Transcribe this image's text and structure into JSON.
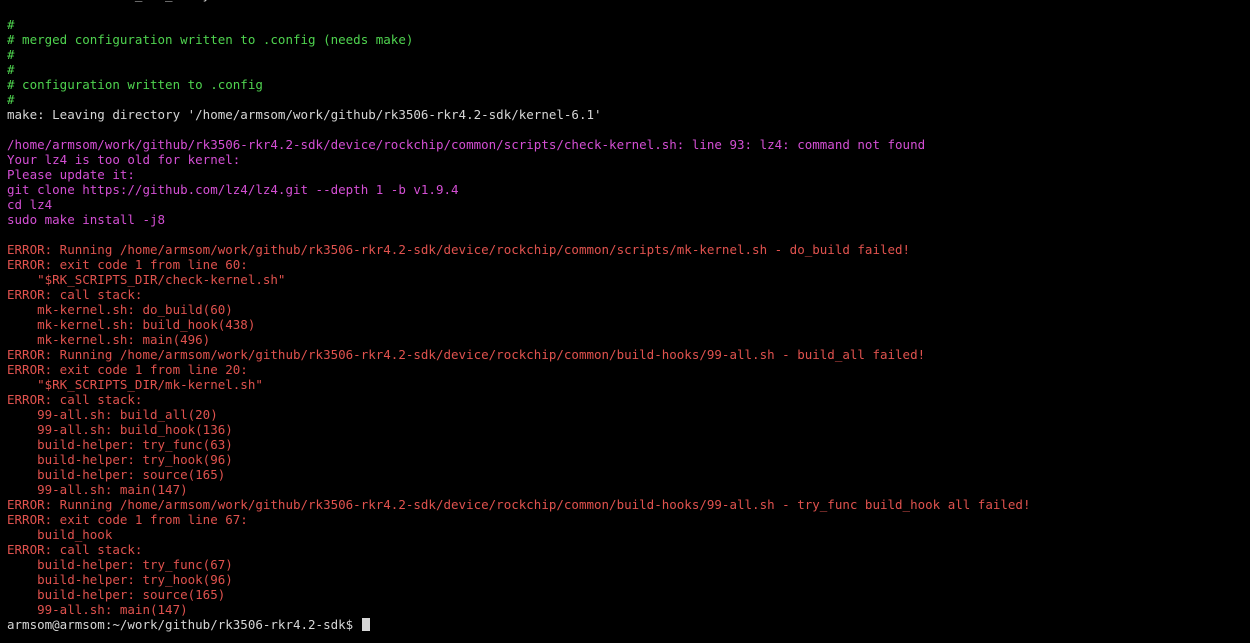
{
  "colors": {
    "background": "#000000",
    "white": "#d6d6d6",
    "green": "#4fd34f",
    "magenta": "#d44fd4",
    "red": "#e0524e",
    "cursor": "#d6d6d6"
  },
  "lines": [
    {
      "text": "New Value: CONFIG_USB_HID=y",
      "color": "white"
    },
    {
      "text": "",
      "color": "white"
    },
    {
      "text": "#",
      "color": "green"
    },
    {
      "text": "# merged configuration written to .config (needs make)",
      "color": "green"
    },
    {
      "text": "#",
      "color": "green"
    },
    {
      "text": "#",
      "color": "green"
    },
    {
      "text": "# configuration written to .config",
      "color": "green"
    },
    {
      "text": "#",
      "color": "green"
    },
    {
      "text": "make: Leaving directory '/home/armsom/work/github/rk3506-rkr4.2-sdk/kernel-6.1'",
      "color": "white"
    },
    {
      "text": "",
      "color": "white"
    },
    {
      "text": "/home/armsom/work/github/rk3506-rkr4.2-sdk/device/rockchip/common/scripts/check-kernel.sh: line 93: lz4: command not found",
      "color": "magenta"
    },
    {
      "text": "Your lz4 is too old for kernel:",
      "color": "magenta"
    },
    {
      "text": "Please update it:",
      "color": "magenta"
    },
    {
      "text": "git clone https://github.com/lz4/lz4.git --depth 1 -b v1.9.4",
      "color": "magenta"
    },
    {
      "text": "cd lz4",
      "color": "magenta"
    },
    {
      "text": "sudo make install -j8",
      "color": "magenta"
    },
    {
      "text": "",
      "color": "white"
    },
    {
      "text": "ERROR: Running /home/armsom/work/github/rk3506-rkr4.2-sdk/device/rockchip/common/scripts/mk-kernel.sh - do_build failed!",
      "color": "red"
    },
    {
      "text": "ERROR: exit code 1 from line 60:",
      "color": "red"
    },
    {
      "text": "    \"$RK_SCRIPTS_DIR/check-kernel.sh\"",
      "color": "red"
    },
    {
      "text": "ERROR: call stack:",
      "color": "red"
    },
    {
      "text": "    mk-kernel.sh: do_build(60)",
      "color": "red"
    },
    {
      "text": "    mk-kernel.sh: build_hook(438)",
      "color": "red"
    },
    {
      "text": "    mk-kernel.sh: main(496)",
      "color": "red"
    },
    {
      "text": "ERROR: Running /home/armsom/work/github/rk3506-rkr4.2-sdk/device/rockchip/common/build-hooks/99-all.sh - build_all failed!",
      "color": "red"
    },
    {
      "text": "ERROR: exit code 1 from line 20:",
      "color": "red"
    },
    {
      "text": "    \"$RK_SCRIPTS_DIR/mk-kernel.sh\"",
      "color": "red"
    },
    {
      "text": "ERROR: call stack:",
      "color": "red"
    },
    {
      "text": "    99-all.sh: build_all(20)",
      "color": "red"
    },
    {
      "text": "    99-all.sh: build_hook(136)",
      "color": "red"
    },
    {
      "text": "    build-helper: try_func(63)",
      "color": "red"
    },
    {
      "text": "    build-helper: try_hook(96)",
      "color": "red"
    },
    {
      "text": "    build-helper: source(165)",
      "color": "red"
    },
    {
      "text": "    99-all.sh: main(147)",
      "color": "red"
    },
    {
      "text": "ERROR: Running /home/armsom/work/github/rk3506-rkr4.2-sdk/device/rockchip/common/build-hooks/99-all.sh - try_func build_hook all failed!",
      "color": "red"
    },
    {
      "text": "ERROR: exit code 1 from line 67:",
      "color": "red"
    },
    {
      "text": "    build_hook",
      "color": "red"
    },
    {
      "text": "ERROR: call stack:",
      "color": "red"
    },
    {
      "text": "    build-helper: try_func(67)",
      "color": "red"
    },
    {
      "text": "    build-helper: try_hook(96)",
      "color": "red"
    },
    {
      "text": "    build-helper: source(165)",
      "color": "red"
    },
    {
      "text": "    99-all.sh: main(147)",
      "color": "red"
    }
  ],
  "prompt": {
    "text": "armsom@armsom:~/work/github/rk3506-rkr4.2-sdk$ ",
    "color": "white"
  }
}
